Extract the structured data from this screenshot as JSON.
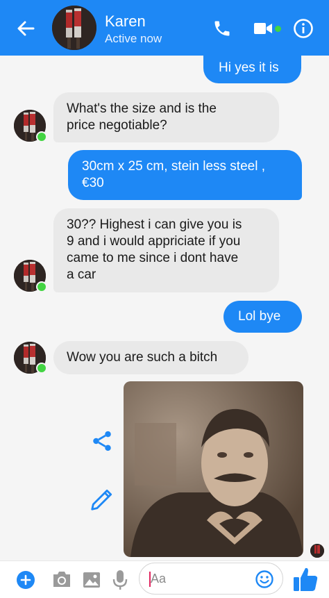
{
  "header": {
    "contact_name": "Karen",
    "status": "Active now"
  },
  "messages": [
    {
      "direction": "out",
      "lines": [
        "Hi yes it is"
      ]
    },
    {
      "direction": "in",
      "lines": [
        "What's the size and is the",
        "price negotiable?"
      ]
    },
    {
      "direction": "out",
      "lines": [
        "30cm x 25 cm, stein less steel ,",
        "€30"
      ]
    },
    {
      "direction": "in",
      "lines": [
        "30?? Highest i can give you is",
        "9 and i would appriciate if you",
        "came to me  since i dont have",
        "a car"
      ]
    },
    {
      "direction": "out",
      "lines": [
        "Lol bye"
      ]
    },
    {
      "direction": "in",
      "lines": [
        "Wow you are such a bitch"
      ]
    }
  ],
  "composer": {
    "placeholder": "Aa"
  },
  "colors": {
    "brand_blue": "#1e88f5",
    "incoming_bubble": "#e9e9e9",
    "online_green": "#42d442"
  },
  "icons": [
    "back-arrow-icon",
    "phone-icon",
    "video-camera-icon",
    "info-icon",
    "share-icon",
    "edit-pencil-icon",
    "plus-icon",
    "camera-icon",
    "gallery-icon",
    "microphone-icon",
    "emoji-icon",
    "thumbs-up-icon"
  ]
}
